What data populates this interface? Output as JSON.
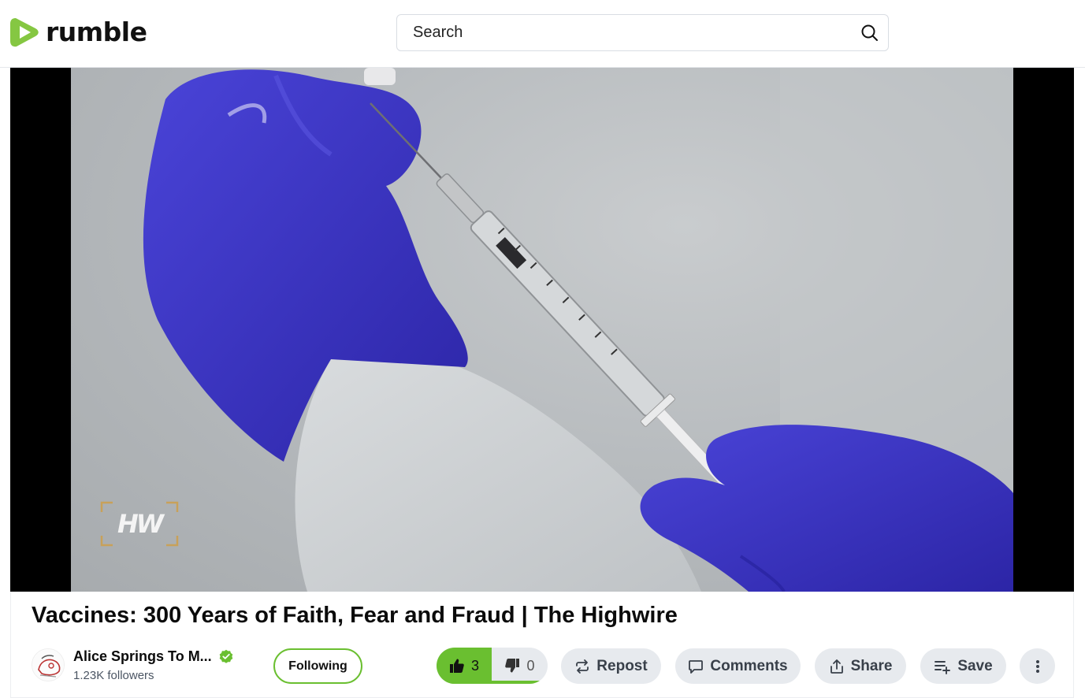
{
  "header": {
    "logo_text": "rumble",
    "search": {
      "placeholder": "Search",
      "value": ""
    }
  },
  "video": {
    "watermark_text": "HW"
  },
  "details": {
    "title": "Vaccines: 300 Years of Faith, Fear and Fraud | The Highwire",
    "channel": {
      "name": "Alice Springs To M...",
      "followers": "1.23K followers",
      "verified": true
    },
    "follow_label": "Following",
    "likes": "3",
    "dislikes": "0",
    "actions": {
      "repost": "Repost",
      "comments": "Comments",
      "share": "Share",
      "save": "Save"
    }
  },
  "colors": {
    "brand_green": "#6abf30",
    "pill_bg": "#e7eaee",
    "glove_blue": "#3b34c4"
  },
  "icons": [
    "rumble-logo-icon",
    "search-icon",
    "verified-icon",
    "thumbs-up-icon",
    "thumbs-down-icon",
    "repost-icon",
    "comment-icon",
    "share-icon",
    "save-icon",
    "more-icon"
  ]
}
